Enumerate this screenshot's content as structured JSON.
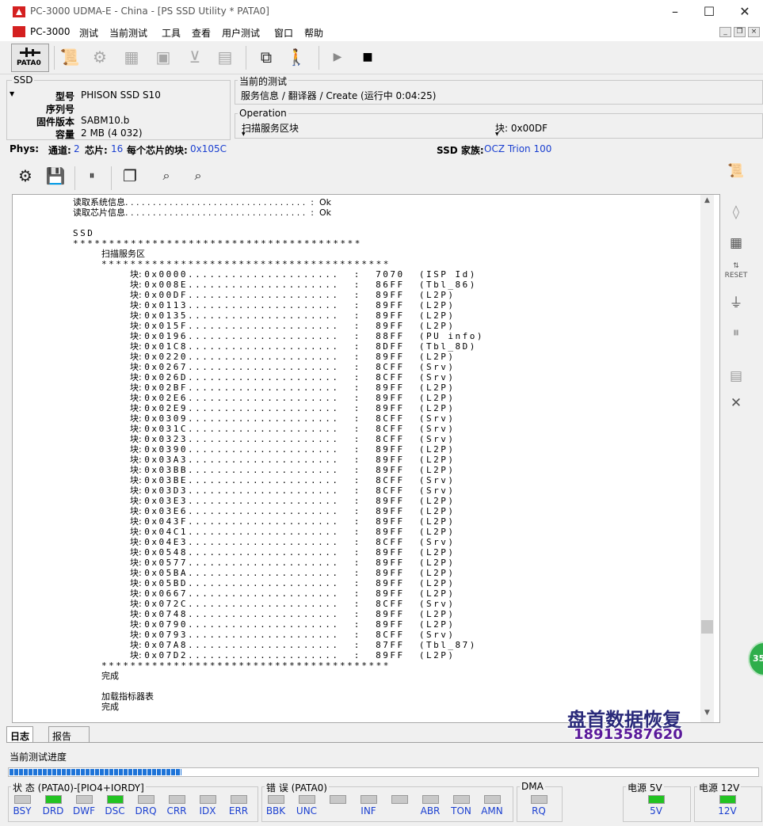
{
  "window": {
    "title": "PC-3000 UDMA-E - China - [PS SSD Utility * PATA0]"
  },
  "menu": [
    "PC-3000",
    "测试",
    "当前测试",
    "工具",
    "查看",
    "用户测试",
    "窗口",
    "帮助"
  ],
  "toolbar": {
    "pata_label": "PATA0"
  },
  "ssd": {
    "legend": "SSD",
    "model_label": "型号",
    "model": "PHISON SSD S10",
    "serial_label": "序列号",
    "serial": "",
    "firmware_label": "固件版本",
    "firmware": "SABM10.b",
    "capacity_label": "容量",
    "capacity": "2 MB (4 032)"
  },
  "current_test": {
    "legend": "当前的测试",
    "text": "服务信息 / 翻译器 / Create (运行中 0:04:25)"
  },
  "operation": {
    "legend": "Operation",
    "text": "扫描服务区块",
    "block": "块: 0x00DF"
  },
  "phys": {
    "label": "Phys:",
    "channels_label": "通道:",
    "channels": "2",
    "chips_label": "芯片:",
    "chips": "16",
    "blocks_label": "每个芯片的块:",
    "blocks": "0x105C",
    "family_label": "SSD 家族:",
    "family": "OCZ Trion 100"
  },
  "log": {
    "header": [
      "读取系统信息. . . . . . . . . . . . . . . . . . . . . . . . . . . . . . . . .  :  Ok",
      "读取芯片信息. . . . . . . . . . . . . . . . . . . . . . . . . . . . . . . . .  :  Ok"
    ],
    "ssd_title": "SSD",
    "stars_long": "****************************************",
    "scan_title": "扫描服务区",
    "stars_scan": "****************************************",
    "entries": [
      {
        "block": "0x0000",
        "sig": "7070",
        "type": "(ISP Id)"
      },
      {
        "block": "0x008E",
        "sig": "86FF",
        "type": "(Tbl_86)"
      },
      {
        "block": "0x00DF",
        "sig": "89FF",
        "type": "(L2P)"
      },
      {
        "block": "0x0113",
        "sig": "89FF",
        "type": "(L2P)"
      },
      {
        "block": "0x0135",
        "sig": "89FF",
        "type": "(L2P)"
      },
      {
        "block": "0x015F",
        "sig": "89FF",
        "type": "(L2P)"
      },
      {
        "block": "0x0196",
        "sig": "88FF",
        "type": "(PU info)"
      },
      {
        "block": "0x01C8",
        "sig": "8DFF",
        "type": "(Tbl_8D)"
      },
      {
        "block": "0x0220",
        "sig": "89FF",
        "type": "(L2P)"
      },
      {
        "block": "0x0267",
        "sig": "8CFF",
        "type": "(Srv)"
      },
      {
        "block": "0x026D",
        "sig": "8CFF",
        "type": "(Srv)"
      },
      {
        "block": "0x02BF",
        "sig": "89FF",
        "type": "(L2P)"
      },
      {
        "block": "0x02E6",
        "sig": "89FF",
        "type": "(L2P)"
      },
      {
        "block": "0x02E9",
        "sig": "89FF",
        "type": "(L2P)"
      },
      {
        "block": "0x0309",
        "sig": "8CFF",
        "type": "(Srv)"
      },
      {
        "block": "0x031C",
        "sig": "8CFF",
        "type": "(Srv)"
      },
      {
        "block": "0x0323",
        "sig": "8CFF",
        "type": "(Srv)"
      },
      {
        "block": "0x0390",
        "sig": "89FF",
        "type": "(L2P)"
      },
      {
        "block": "0x03A3",
        "sig": "89FF",
        "type": "(L2P)"
      },
      {
        "block": "0x03BB",
        "sig": "89FF",
        "type": "(L2P)"
      },
      {
        "block": "0x03BE",
        "sig": "8CFF",
        "type": "(Srv)"
      },
      {
        "block": "0x03D3",
        "sig": "8CFF",
        "type": "(Srv)"
      },
      {
        "block": "0x03E3",
        "sig": "89FF",
        "type": "(L2P)"
      },
      {
        "block": "0x03E6",
        "sig": "89FF",
        "type": "(L2P)"
      },
      {
        "block": "0x043F",
        "sig": "89FF",
        "type": "(L2P)"
      },
      {
        "block": "0x04C1",
        "sig": "89FF",
        "type": "(L2P)"
      },
      {
        "block": "0x04E3",
        "sig": "8CFF",
        "type": "(Srv)"
      },
      {
        "block": "0x0548",
        "sig": "89FF",
        "type": "(L2P)"
      },
      {
        "block": "0x0577",
        "sig": "89FF",
        "type": "(L2P)"
      },
      {
        "block": "0x05BA",
        "sig": "89FF",
        "type": "(L2P)"
      },
      {
        "block": "0x05BD",
        "sig": "89FF",
        "type": "(L2P)"
      },
      {
        "block": "0x0667",
        "sig": "89FF",
        "type": "(L2P)"
      },
      {
        "block": "0x072C",
        "sig": "8CFF",
        "type": "(Srv)"
      },
      {
        "block": "0x0748",
        "sig": "89FF",
        "type": "(L2P)"
      },
      {
        "block": "0x0790",
        "sig": "89FF",
        "type": "(L2P)"
      },
      {
        "block": "0x0793",
        "sig": "8CFF",
        "type": "(Srv)"
      },
      {
        "block": "0x07A8",
        "sig": "87FF",
        "type": "(Tbl_87)"
      },
      {
        "block": "0x07D2",
        "sig": "89FF",
        "type": "(L2P)"
      }
    ],
    "entry_prefix": "块:",
    "stars_end": "****************************************",
    "done1": "完成",
    "load_indicator": "加载指标器表",
    "done2": "完成"
  },
  "tabs": {
    "log": "日志",
    "report": "报告"
  },
  "progress": {
    "label": "当前测试进度",
    "fraction": 0.23
  },
  "status": {
    "legend": "状 态 (PATA0)-[PIO4+IORDY]",
    "leds": [
      {
        "label": "BSY",
        "on": false
      },
      {
        "label": "DRD",
        "on": true
      },
      {
        "label": "DWF",
        "on": false
      },
      {
        "label": "DSC",
        "on": true
      },
      {
        "label": "DRQ",
        "on": false
      },
      {
        "label": "CRR",
        "on": false
      },
      {
        "label": "IDX",
        "on": false
      },
      {
        "label": "ERR",
        "on": false
      }
    ]
  },
  "errors": {
    "legend": "错 误 (PATA0)",
    "leds": [
      {
        "label": "BBK",
        "on": false
      },
      {
        "label": "UNC",
        "on": false
      },
      {
        "label": "",
        "on": false
      },
      {
        "label": "INF",
        "on": false
      },
      {
        "label": "",
        "on": false
      },
      {
        "label": "ABR",
        "on": false
      },
      {
        "label": "TON",
        "on": false
      },
      {
        "label": "AMN",
        "on": false
      }
    ]
  },
  "dma": {
    "legend": "DMA",
    "label": "RQ"
  },
  "power5": {
    "legend": "电源 5V",
    "label": "5V"
  },
  "power12": {
    "legend": "电源 12V",
    "label": "12V"
  },
  "watermark": {
    "name": "盘首数据恢复",
    "phone": "18913587620"
  },
  "badge": "35"
}
